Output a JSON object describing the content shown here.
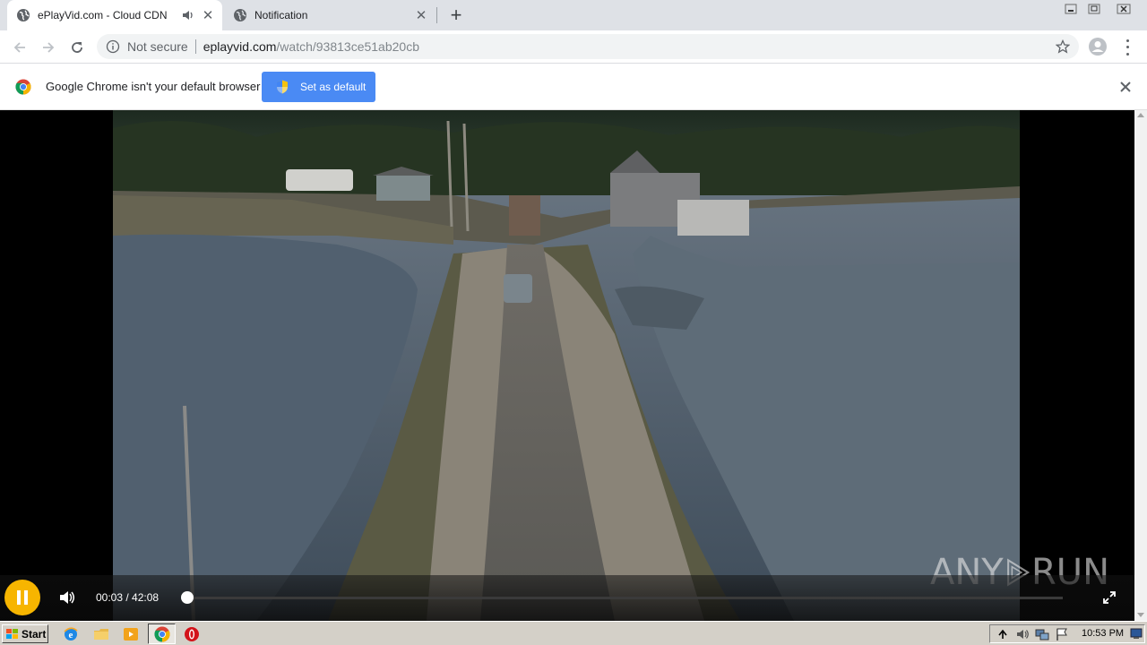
{
  "browser": {
    "tabs": [
      {
        "title": "ePlayVid.com - Cloud CDN",
        "active": true,
        "audio": true
      },
      {
        "title": "Notification",
        "active": false,
        "audio": false
      }
    ],
    "address": {
      "security_label": "Not secure",
      "host": "eplayvid.com",
      "path": "/watch/93813ce51ab20cb"
    }
  },
  "infobar": {
    "message": "Google Chrome isn't your default browser",
    "button_label": "Set as default"
  },
  "player": {
    "state": "playing",
    "time_display": "00:03 / 42:08",
    "current_seconds": 3,
    "duration_seconds": 2528,
    "accent_color": "#f7b500"
  },
  "watermark": {
    "left": "ANY",
    "right": "RUN"
  },
  "taskbar": {
    "start_label": "Start",
    "quicklaunch": [
      "internet-explorer-icon",
      "folder-icon",
      "media-player-icon",
      "chrome-icon",
      "opera-icon"
    ],
    "clock": "10:53 PM"
  }
}
